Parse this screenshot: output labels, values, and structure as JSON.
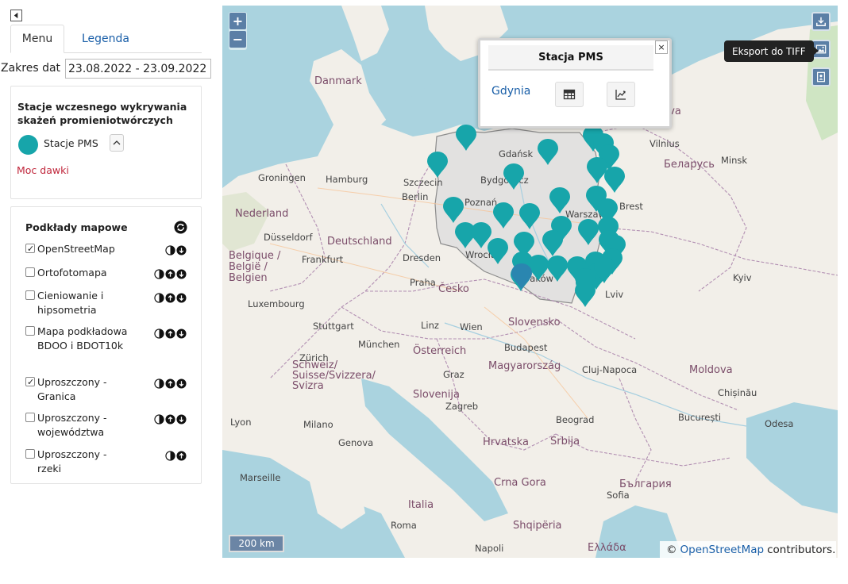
{
  "sidebar": {
    "tabs": [
      {
        "label": "Menu",
        "active": true
      },
      {
        "label": "Legenda",
        "active": false
      }
    ],
    "date_range": {
      "label": "Zakres dat",
      "value": "23.08.2022 - 23.09.2022"
    },
    "stations": {
      "title": "Stacje wczesnego wykrywania skażeń promieniotwórczych",
      "layer_label": "Stacje PMS",
      "dose_link": "Moc dawki",
      "color": "#17a5aa"
    },
    "basemaps": {
      "title": "Podkłady mapowe",
      "layers": [
        {
          "label": "OpenStreetMap",
          "checked": true
        },
        {
          "label": "Ortofotomapa",
          "checked": false
        },
        {
          "label": "Cieniowanie i hipsometria",
          "checked": false
        },
        {
          "label": "Mapa podkładowa BDOO i BDOT10k",
          "checked": false
        },
        {
          "label": "Uproszczony - Granica",
          "checked": true
        },
        {
          "label": "Uproszczony - województwa",
          "checked": false
        },
        {
          "label": "Uproszczony - rzeki",
          "checked": false
        }
      ]
    }
  },
  "map": {
    "zoom_in": "+",
    "zoom_out": "−",
    "tooltip": "Eksport do TIFF",
    "popup": {
      "title": "Stacja PMS",
      "close": "×",
      "station": "Gdynia"
    },
    "scale": "200 km",
    "attribution": {
      "prefix": "©",
      "link": "OpenStreetMap",
      "suffix": "contributors."
    },
    "labels": {
      "countries": [
        "Danmark",
        "Nederland",
        "Deutschland",
        "Česko",
        "Slovensko",
        "Österreich",
        "Magyarország",
        "Schweiz/ Suisse/Svizzera/ Svizra",
        "Slovenija",
        "Hrvatska",
        "Italia",
        "Belgique / België / Belgien",
        "Luxembourg",
        "Беларусь",
        "Moldova",
        "Srbija",
        "Crna Gora",
        "Shqipëria",
        "Ελλάδα",
        "България",
        "Lietuva"
      ],
      "cities": [
        "Hamburg",
        "Groningen",
        "Berlin",
        "Szczecin",
        "Gdańsk",
        "Bydgoszcz",
        "Poznań",
        "Warszawa",
        "Vilnius",
        "Minsk",
        "Brest",
        "Lviv",
        "Kyiv",
        "Dresden",
        "Praha",
        "Wrocław",
        "Frankfurt",
        "Düsseldorf",
        "München",
        "Wien",
        "Budapest",
        "Zagreb",
        "Milano",
        "Beograd",
        "București",
        "Sofia",
        "Roma",
        "Napoli",
        "Marseille",
        "Lyon",
        "Genova",
        "Zürich",
        "Linz",
        "Graz",
        "Cluj-Napoca",
        "Chișinău",
        "Odesa",
        "Kraków",
        "Stuttgart"
      ]
    },
    "marker_color": "#17a5aa",
    "marker_selected_color": "#2a86b0",
    "stations_count": 55
  }
}
